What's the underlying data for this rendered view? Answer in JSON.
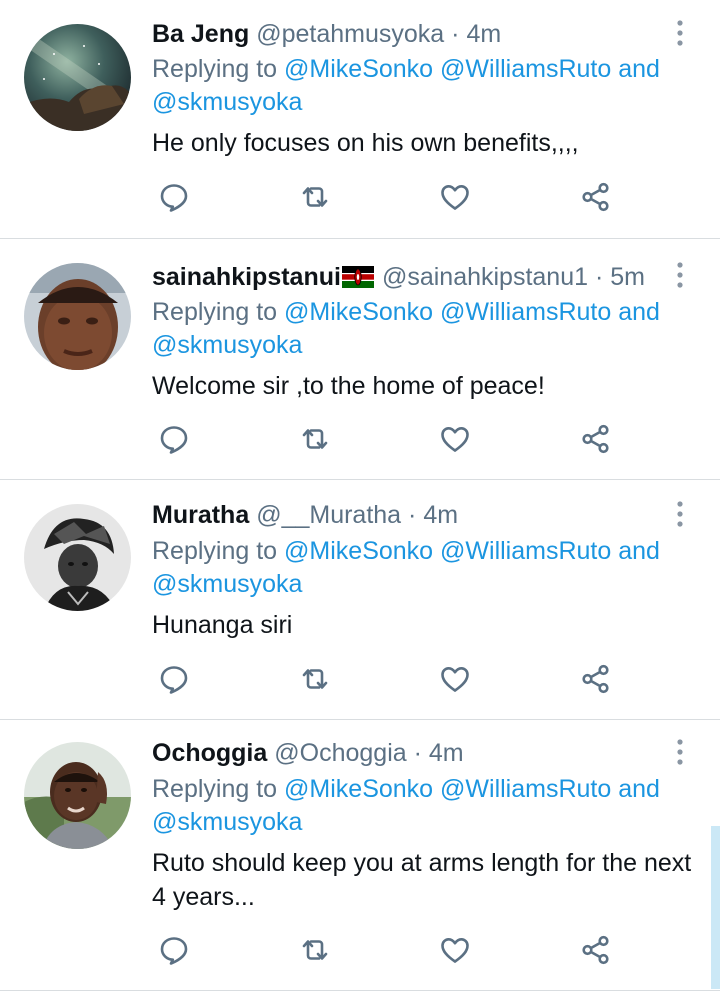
{
  "icons": {
    "reply": "speech-bubble",
    "retweet": "retweet-arrows",
    "like": "heart",
    "share": "share-nodes",
    "more": "vertical-ellipsis"
  },
  "colors": {
    "mention": "#1b95e0",
    "secondary_text": "#5b7083",
    "divider": "#d9dde0"
  },
  "tweets": [
    {
      "name": "Ba Jeng",
      "handle": "@petahmusyoka",
      "sep": "·",
      "time": "4m",
      "reply_prefix": "Replying to ",
      "mention_1": "@MikeSonko",
      "mention_2": "@WilliamsRuto",
      "mention_and": " and",
      "mention_3": "@skmusyoka",
      "text": "He only focuses on his own benefits,,,,"
    },
    {
      "name": "sainahkipstanui",
      "handle": "@sainahkipstanu1",
      "sep": "·",
      "time": "5m",
      "reply_prefix": "Replying to ",
      "mention_1": "@MikeSonko",
      "mention_2": "@WilliamsRuto",
      "mention_and": " and",
      "mention_3": "@skmusyoka",
      "text": "Welcome sir ,to the home of peace!"
    },
    {
      "name": "Muratha",
      "handle": "@__Muratha",
      "sep": "·",
      "time": "4m",
      "reply_prefix": "Replying to ",
      "mention_1": "@MikeSonko",
      "mention_2": "@WilliamsRuto",
      "mention_and": " and",
      "mention_3": "@skmusyoka",
      "text": "Hunanga siri"
    },
    {
      "name": "Ochoggia",
      "handle": "@Ochoggia",
      "sep": "·",
      "time": "4m",
      "reply_prefix": "Replying to ",
      "mention_1": "@MikeSonko",
      "mention_2": "@WilliamsRuto",
      "mention_and": " and",
      "mention_3": "@skmusyoka",
      "text": "Ruto should keep you at arms length for the next 4 years..."
    }
  ]
}
